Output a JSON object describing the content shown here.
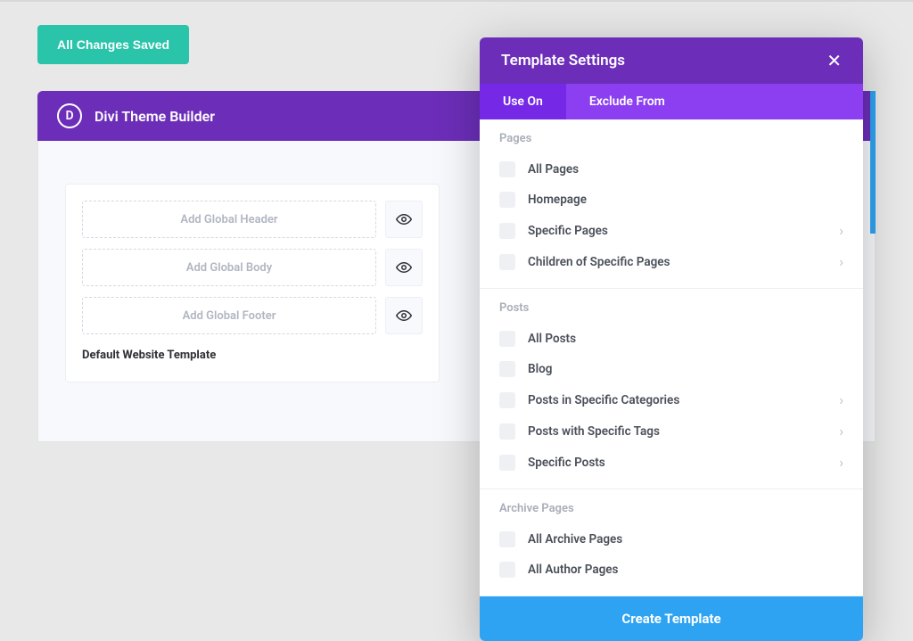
{
  "status_button": "All Changes Saved",
  "builder": {
    "title": "Divi Theme Builder",
    "logo_letter": "D"
  },
  "template_card": {
    "slots": [
      "Add Global Header",
      "Add Global Body",
      "Add Global Footer"
    ],
    "footer_label": "Default Website Template"
  },
  "modal": {
    "title": "Template Settings",
    "tabs": {
      "use_on": "Use On",
      "exclude_from": "Exclude From"
    },
    "sections": [
      {
        "title": "Pages",
        "options": [
          {
            "label": "All Pages",
            "chevron": false
          },
          {
            "label": "Homepage",
            "chevron": false
          },
          {
            "label": "Specific Pages",
            "chevron": true
          },
          {
            "label": "Children of Specific Pages",
            "chevron": true
          }
        ]
      },
      {
        "title": "Posts",
        "options": [
          {
            "label": "All Posts",
            "chevron": false
          },
          {
            "label": "Blog",
            "chevron": false
          },
          {
            "label": "Posts in Specific Categories",
            "chevron": true
          },
          {
            "label": "Posts with Specific Tags",
            "chevron": true
          },
          {
            "label": "Specific Posts",
            "chevron": true
          }
        ]
      },
      {
        "title": "Archive Pages",
        "options": [
          {
            "label": "All Archive Pages",
            "chevron": false
          },
          {
            "label": "All Author Pages",
            "chevron": false
          }
        ]
      }
    ],
    "create_button": "Create Template"
  },
  "icons": {
    "chevron_right": "›"
  }
}
